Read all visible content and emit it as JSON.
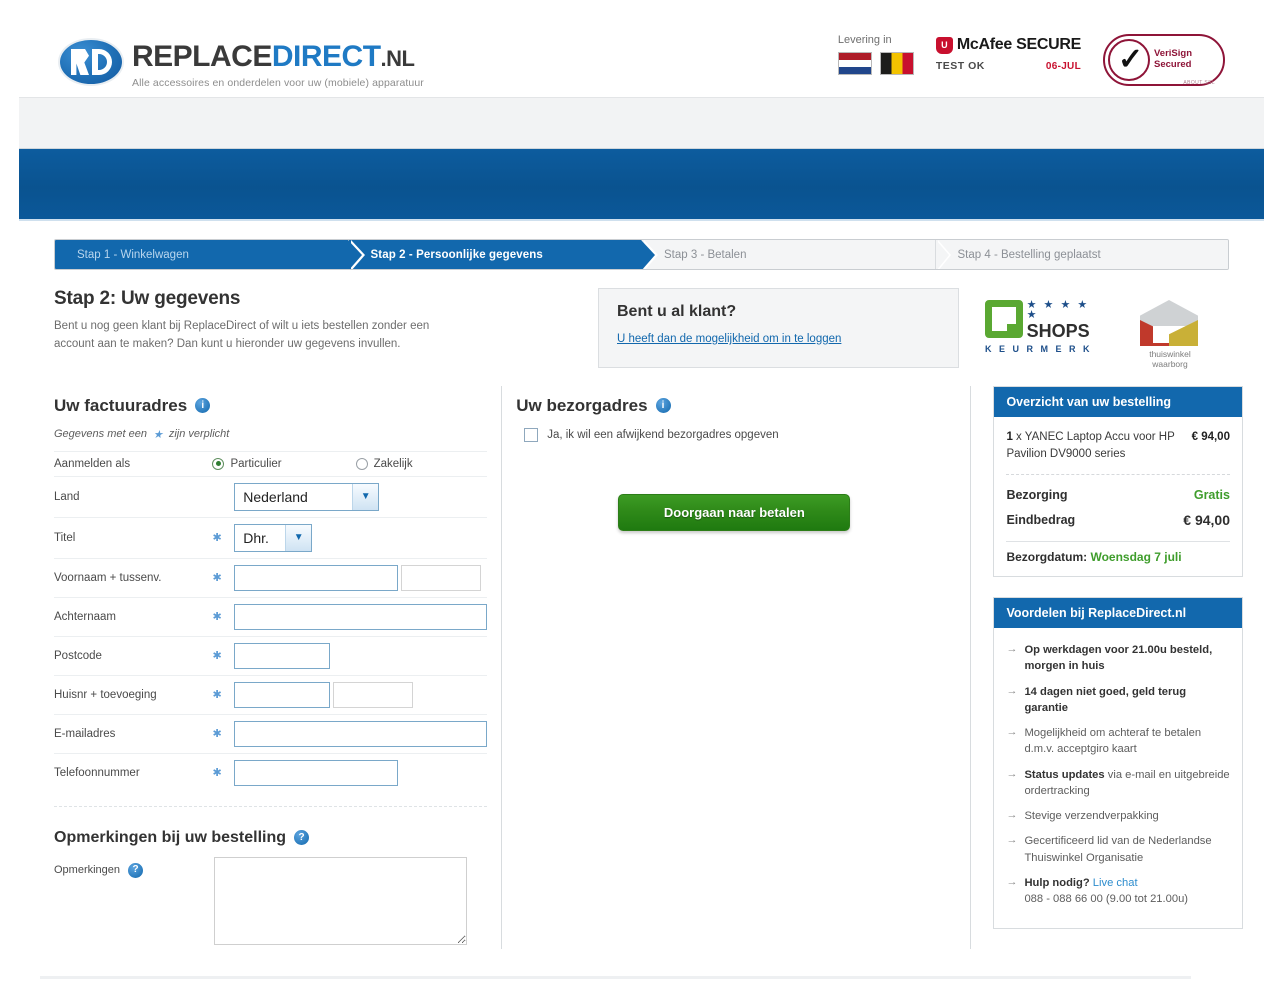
{
  "header": {
    "logo": {
      "part1": "REPLACE",
      "part2": "DIRECT",
      "part3": ".NL",
      "tagline": "Alle accessoires en onderdelen voor uw (mobiele) apparatuur"
    },
    "levering_label": "Levering in",
    "flag_nl_name": "netherlands-flag",
    "flag_be_name": "belgium-flag",
    "mcafee": {
      "shield": "U",
      "name_1": "McAfee ",
      "name_2": "SECURE",
      "trademark": "™",
      "status": "TEST OK",
      "date": "06-JUL"
    },
    "verisign": {
      "line1": "VeriSign",
      "line2": "Secured",
      "tiny": "ABOUT SSL"
    }
  },
  "steps": [
    {
      "label": "Stap 1 - Winkelwagen",
      "state": "done"
    },
    {
      "label": "Stap 2 - Persoonlijke gegevens",
      "state": "active"
    },
    {
      "label": "Stap 3 - Betalen",
      "state": "todo"
    },
    {
      "label": "Stap 4 - Bestelling geplaatst",
      "state": "todo"
    }
  ],
  "intro": {
    "title": "Stap 2: Uw gegevens",
    "text": "Bent u nog geen klant bij ReplaceDirect of wilt u iets bestellen zonder een account aan te maken? Dan kunt u hieronder uw gegevens invullen."
  },
  "klantbox": {
    "title": "Bent u al klant?",
    "link": "U heeft dan de mogelijkheid om in te loggen"
  },
  "seals": {
    "qshops": {
      "stars": "★ ★ ★ ★ ★",
      "word": "SHOPS",
      "keurmerk": "K E U R M E R K"
    },
    "thuiswinkel": {
      "line1": "thuiswinkel",
      "line2": "waarborg"
    }
  },
  "billing": {
    "title": "Uw factuuradres",
    "required_note_pre": "Gegevens met een",
    "required_star": "★",
    "required_note_post": "zijn verplicht",
    "aanmelden_label": "Aanmelden als",
    "options": [
      {
        "label": "Particulier",
        "selected": true
      },
      {
        "label": "Zakelijk",
        "selected": false
      }
    ],
    "fields": {
      "land_label": "Land",
      "land_value": "Nederland",
      "titel_label": "Titel",
      "titel_value": "Dhr.",
      "voornaam_label": "Voornaam + tussenv.",
      "voornaam_value": "",
      "tussenvoegsel_value": "",
      "achternaam_label": "Achternaam",
      "achternaam_value": "",
      "postcode_label": "Postcode",
      "postcode_value": "",
      "huisnr_label": "Huisnr + toevoeging",
      "huisnr_value": "",
      "toevoeging_value": "",
      "email_label": "E-mailadres",
      "email_value": "",
      "telefoon_label": "Telefoonnummer",
      "telefoon_value": ""
    }
  },
  "remarks": {
    "title": "Opmerkingen bij uw bestelling",
    "field_label": "Opmerkingen",
    "value": ""
  },
  "shipping": {
    "title": "Uw bezorgadres",
    "checkbox_label": "Ja, ik wil een afwijkend bezorgadres opgeven",
    "checkbox_checked": false,
    "submit_label": "Doorgaan naar betalen"
  },
  "order_summary": {
    "heading": "Overzicht van uw bestelling",
    "item_qty": "1",
    "item_sep": " x ",
    "item_name": "YANEC Laptop Accu voor HP Pavilion DV9000 series",
    "item_price": "€ 94,00",
    "shipping_label": "Bezorging",
    "shipping_value": "Gratis",
    "total_label": "Eindbedrag",
    "total_value": "€ 94,00",
    "delivery_label": "Bezorgdatum:",
    "delivery_value": "Woensdag 7 juli"
  },
  "benefits": {
    "heading": "Voordelen bij ReplaceDirect.nl",
    "items": [
      {
        "strong": "Op werkdagen voor 21.00u besteld, morgen in huis",
        "rest": ""
      },
      {
        "strong": "14 dagen niet goed, geld terug garantie",
        "rest": ""
      },
      {
        "strong": "",
        "rest": "Mogelijkheid om achteraf te betalen d.m.v. acceptgiro kaart"
      },
      {
        "strong": "Status updates",
        "rest": " via e-mail en uitgebreide ordertracking"
      },
      {
        "strong": "",
        "rest": "Stevige verzendverpakking"
      },
      {
        "strong": "",
        "rest": "Gecertificeerd lid van de Nederlandse Thuiswinkel Organisatie"
      },
      {
        "strong": "Hulp nodig?",
        "rest": " Live chat",
        "phone": "088 - 088 66 00 (9.00 tot 21.00u)"
      }
    ],
    "live_chat": "Live chat",
    "phone": "088 - 088 66 00 (9.00 tot 21.00u)"
  },
  "colors": {
    "brand_blue": "#1268ad",
    "accent_green": "#2f8a19",
    "free_green": "#3f9d2c",
    "link_blue": "#1268ad"
  }
}
